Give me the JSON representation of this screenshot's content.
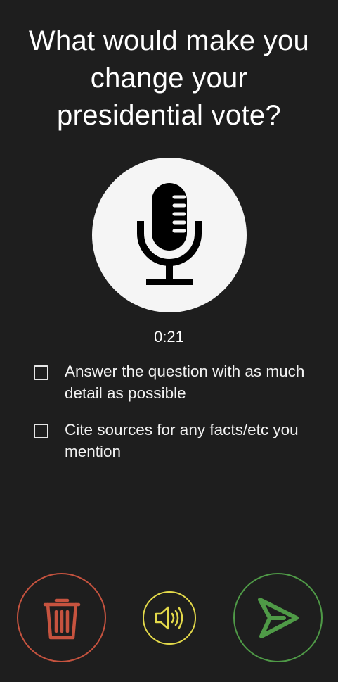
{
  "question": {
    "text": "What would make you change your presidential vote?"
  },
  "recorder": {
    "mic_icon": "microphone-icon",
    "elapsed": "0:21"
  },
  "checklist": [
    {
      "label": "Answer the question with as much detail as possible",
      "checked": false
    },
    {
      "label": "Cite sources for any facts/etc you mention",
      "checked": false
    }
  ],
  "actions": {
    "delete_icon": "trash-icon",
    "sound_icon": "speaker-icon",
    "send_icon": "send-icon"
  },
  "colors": {
    "background": "#1e1e1e",
    "delete": "#c6533f",
    "sound": "#e3d94a",
    "send": "#4f9a47"
  }
}
